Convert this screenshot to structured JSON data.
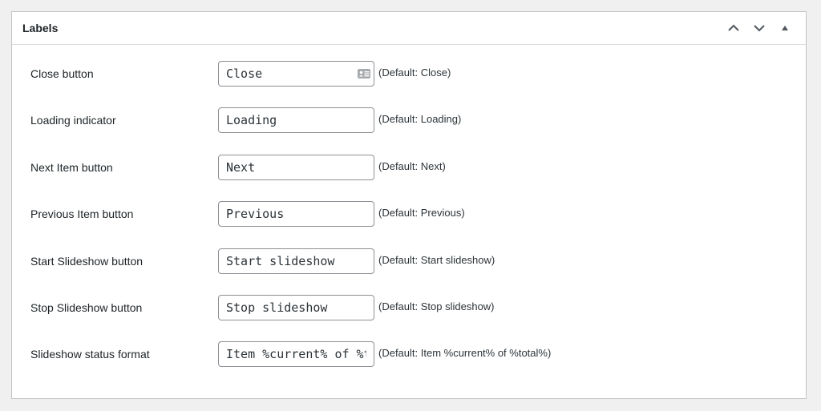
{
  "panel": {
    "title": "Labels",
    "actions": [
      {
        "name": "move-up",
        "icon": "chevron-up-icon"
      },
      {
        "name": "move-down",
        "icon": "chevron-down-icon"
      },
      {
        "name": "toggle-panel",
        "icon": "triangle-up-icon"
      }
    ]
  },
  "fields": [
    {
      "label": "Close button",
      "value": "Close",
      "default": "(Default: Close)"
    },
    {
      "label": "Loading indicator",
      "value": "Loading",
      "default": "(Default: Loading)"
    },
    {
      "label": "Next Item button",
      "value": "Next",
      "default": "(Default: Next)"
    },
    {
      "label": "Previous Item button",
      "value": "Previous",
      "default": "(Default: Previous)"
    },
    {
      "label": "Start Slideshow button",
      "value": "Start slideshow",
      "default": "(Default: Start slideshow)"
    },
    {
      "label": "Stop Slideshow button",
      "value": "Stop slideshow",
      "default": "(Default: Stop slideshow)"
    },
    {
      "label": "Slideshow status format",
      "value": "Item %current% of %total%",
      "default": "(Default: Item %current% of %total%)"
    }
  ],
  "autofill_icon": "contact-card-icon"
}
